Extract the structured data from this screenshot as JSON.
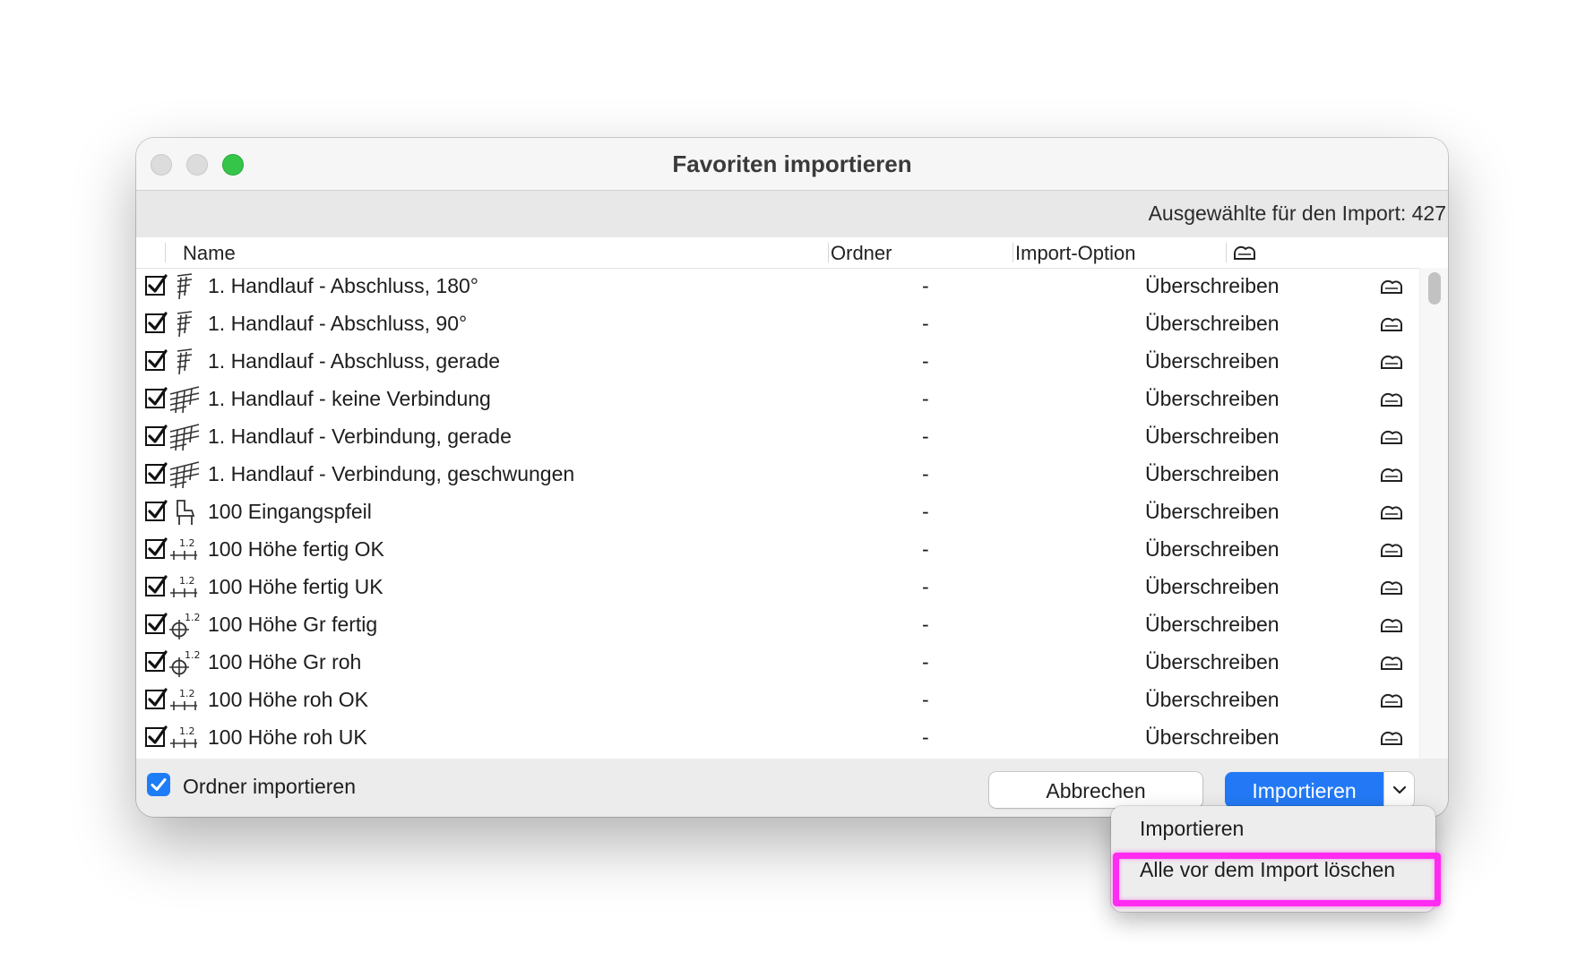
{
  "window": {
    "title": "Favoriten importieren",
    "selected_label": "Ausgewählte für den Import: 427"
  },
  "table": {
    "headers": {
      "name": "Name",
      "folder": "Ordner",
      "option": "Import-Option"
    },
    "rows": [
      {
        "checked": true,
        "icon": "railing-end-icon",
        "name": "1. Handlauf - Abschluss, 180°",
        "folder": "-",
        "option": "Überschreiben"
      },
      {
        "checked": true,
        "icon": "railing-end-icon",
        "name": "1. Handlauf - Abschluss, 90°",
        "folder": "-",
        "option": "Überschreiben"
      },
      {
        "checked": true,
        "icon": "railing-end-icon",
        "name": "1. Handlauf - Abschluss, gerade",
        "folder": "-",
        "option": "Überschreiben"
      },
      {
        "checked": true,
        "icon": "railing-connection-icon",
        "name": "1. Handlauf - keine Verbindung",
        "folder": "-",
        "option": "Überschreiben"
      },
      {
        "checked": true,
        "icon": "railing-connection-icon",
        "name": "1. Handlauf - Verbindung, gerade",
        "folder": "-",
        "option": "Überschreiben"
      },
      {
        "checked": true,
        "icon": "railing-connection-icon",
        "name": "1. Handlauf - Verbindung, geschwungen",
        "folder": "-",
        "option": "Überschreiben"
      },
      {
        "checked": true,
        "icon": "chair-icon",
        "name": "100 Eingangspfeil",
        "folder": "-",
        "option": "Überschreiben"
      },
      {
        "checked": true,
        "icon": "level-dimension-icon",
        "name": "100 Höhe fertig OK",
        "folder": "-",
        "option": "Überschreiben"
      },
      {
        "checked": true,
        "icon": "level-dimension-icon",
        "name": "100 Höhe fertig UK",
        "folder": "-",
        "option": "Überschreiben"
      },
      {
        "checked": true,
        "icon": "crosshair-level-icon",
        "name": "100 Höhe Gr fertig",
        "folder": "-",
        "option": "Überschreiben"
      },
      {
        "checked": true,
        "icon": "crosshair-level-icon",
        "name": "100 Höhe Gr roh",
        "folder": "-",
        "option": "Überschreiben"
      },
      {
        "checked": true,
        "icon": "level-dimension-icon",
        "name": "100 Höhe roh OK",
        "folder": "-",
        "option": "Überschreiben"
      },
      {
        "checked": true,
        "icon": "level-dimension-icon",
        "name": "100 Höhe roh UK",
        "folder": "-",
        "option": "Überschreiben"
      }
    ]
  },
  "footer": {
    "folder_import_label": "Ordner importieren",
    "folder_import_checked": true,
    "cancel_label": "Abbrechen",
    "import_label": "Importieren"
  },
  "menu": {
    "items": [
      "Importieren",
      "Alle vor dem Import löschen"
    ],
    "highlighted_index": 1
  },
  "colors": {
    "accent": "#2379f5",
    "highlight": "#ff2bf0",
    "close_button": "#dcdcdc",
    "zoom_button": "#35c649"
  }
}
